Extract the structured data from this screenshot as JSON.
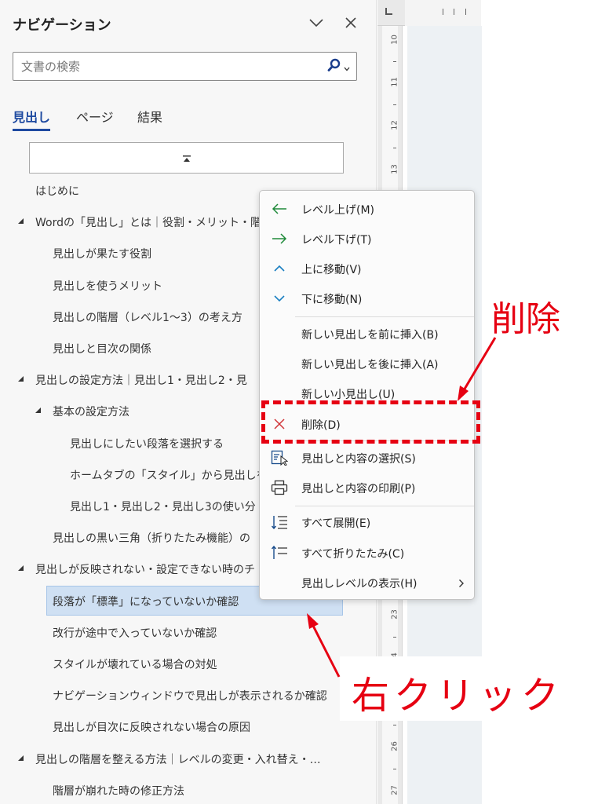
{
  "nav_pane": {
    "title": "ナビゲーション",
    "search": {
      "placeholder": "文書の検索",
      "value": ""
    },
    "tabs": [
      {
        "label": "見出し",
        "active": true
      },
      {
        "label": "ページ",
        "active": false
      },
      {
        "label": "結果",
        "active": false
      }
    ],
    "headings": [
      {
        "label": "はじめに",
        "level": 1,
        "expandable": false
      },
      {
        "label": "Wordの「見出し」とは｜役割・メリット・階層",
        "level": 1,
        "expandable": true
      },
      {
        "label": "見出しが果たす役割",
        "level": 2,
        "expandable": false
      },
      {
        "label": "見出しを使うメリット",
        "level": 2,
        "expandable": false
      },
      {
        "label": "見出しの階層（レベル1〜3）の考え方",
        "level": 2,
        "expandable": false
      },
      {
        "label": "見出しと目次の関係",
        "level": 2,
        "expandable": false
      },
      {
        "label": "見出しの設定方法｜見出し1・見出し2・見",
        "level": 1,
        "expandable": true
      },
      {
        "label": "基本の設定方法",
        "level": 2,
        "expandable": true
      },
      {
        "label": "見出しにしたい段落を選択する",
        "level": 3,
        "expandable": false
      },
      {
        "label": "ホームタブの「スタイル」から見出しを適",
        "level": 3,
        "expandable": false
      },
      {
        "label": "見出し1・見出し2・見出し3の使い分",
        "level": 3,
        "expandable": false
      },
      {
        "label": "見出しの黒い三角（折りたたみ機能）の",
        "level": 2,
        "expandable": false
      },
      {
        "label": "見出しが反映されない・設定できない時のチ",
        "level": 1,
        "expandable": true
      },
      {
        "label": "段落が「標準」になっていないか確認",
        "level": 2,
        "expandable": false,
        "selected": true
      },
      {
        "label": "改行が途中で入っていないか確認",
        "level": 2,
        "expandable": false
      },
      {
        "label": "スタイルが壊れている場合の対処",
        "level": 2,
        "expandable": false
      },
      {
        "label": "ナビゲーションウィンドウで見出しが表示されるか確認",
        "level": 2,
        "expandable": false
      },
      {
        "label": "見出しが目次に反映されない場合の原因",
        "level": 2,
        "expandable": false
      },
      {
        "label": "見出しの階層を整える方法｜レベルの変更・入れ替え・…",
        "level": 1,
        "expandable": true
      },
      {
        "label": "階層が崩れた時の修正方法",
        "level": 2,
        "expandable": false
      }
    ]
  },
  "ruler": {
    "vertical_numbers": [
      "10",
      "11",
      "12",
      "13",
      "23",
      "24",
      "26",
      "27"
    ]
  },
  "context_menu": {
    "items": [
      {
        "label": "レベル上げ(M)",
        "icon": "arrow-left-icon",
        "color": "#1f8a3a"
      },
      {
        "label": "レベル下げ(T)",
        "icon": "arrow-right-icon",
        "color": "#1f8a3a"
      },
      {
        "label": "上に移動(V)",
        "icon": "chevron-up-icon",
        "color": "#1a7fc1"
      },
      {
        "label": "下に移動(N)",
        "icon": "chevron-down-icon",
        "color": "#1a7fc1"
      },
      {
        "label": "新しい見出しを前に挿入(B)",
        "icon": "",
        "color": ""
      },
      {
        "label": "新しい見出しを後に挿入(A)",
        "icon": "",
        "color": ""
      },
      {
        "label": "新しい小見出し(U)",
        "icon": "",
        "color": ""
      },
      {
        "label": "削除(D)",
        "icon": "close-icon",
        "color": "#d13438"
      },
      {
        "label": "見出しと内容の選択(S)",
        "icon": "select-content-icon",
        "color": "#1a4d8c"
      },
      {
        "label": "見出しと内容の印刷(P)",
        "icon": "printer-icon",
        "color": "#333333"
      },
      {
        "label": "すべて展開(E)",
        "icon": "expand-all-icon",
        "color": "#1a4d8c"
      },
      {
        "label": "すべて折りたたみ(C)",
        "icon": "collapse-all-icon",
        "color": "#1a4d8c"
      },
      {
        "label": "見出しレベルの表示(H)",
        "icon": "",
        "color": "",
        "submenu": true
      }
    ]
  },
  "annotations": {
    "delete_label": "削除",
    "right_click_label": "右クリック",
    "color": "#e60012"
  }
}
